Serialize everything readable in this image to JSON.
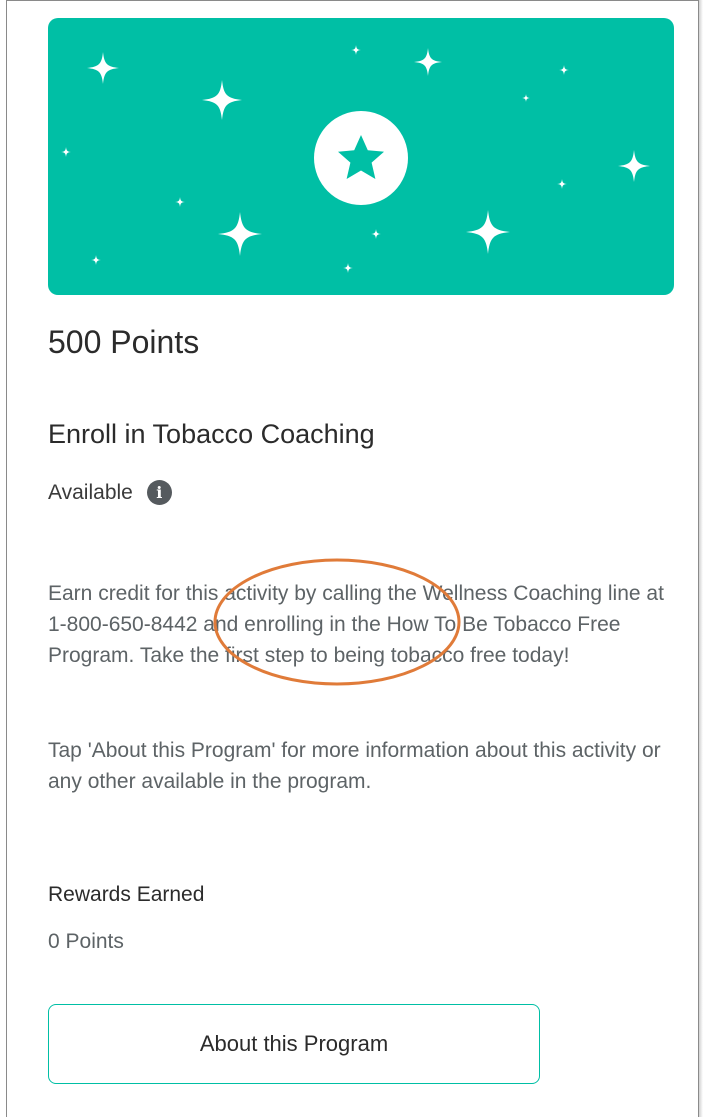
{
  "card": {
    "points_title": "500 Points",
    "activity_title": "Enroll in Tobacco Coaching",
    "status": "Available",
    "description": "Earn credit for this activity by calling the Wellness Coaching line at 1-800-650-8442 and enrolling in the How To Be Tobacco Free Program. Take the first step to being tobacco free today!",
    "description_2": "Tap 'About this Program' for more information about this activity or any other available in the program.",
    "rewards_label": "Rewards Earned",
    "rewards_value": "0 Points",
    "about_button_label": "About this Program"
  },
  "icons": {
    "banner": "star-badge-icon",
    "status_info": "info-icon"
  },
  "colors": {
    "accent": "#00bfa5",
    "annotation": "#e07b39",
    "info_icon_bg": "#555a5e"
  }
}
